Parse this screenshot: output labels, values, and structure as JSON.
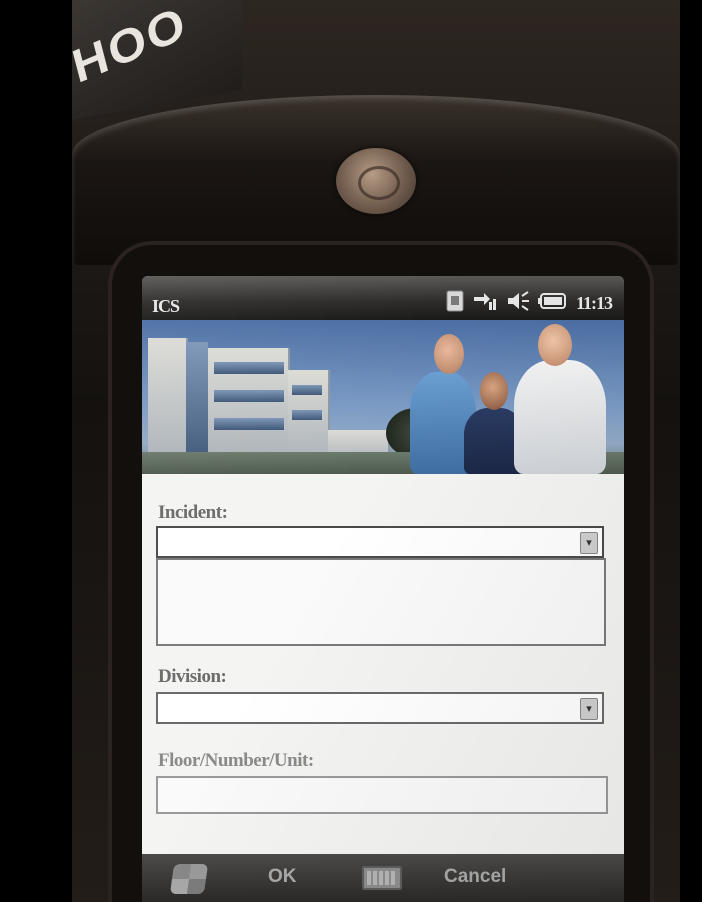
{
  "device": {
    "sticker_text": "HOO"
  },
  "status_bar": {
    "app_title": "ICS",
    "time": "11:13",
    "icons": [
      "sim-card-icon",
      "signal-transfer-icon",
      "volume-icon",
      "battery-icon"
    ]
  },
  "banner": {
    "image_name": "hospital-banner-image"
  },
  "form": {
    "incident_label": "Incident:",
    "incident_value": "",
    "incident_details_value": "",
    "division_label": "Division:",
    "division_value": "",
    "floor_label": "Floor/Number/Unit:",
    "floor_value": ""
  },
  "softkeys": {
    "ok_label": "OK",
    "cancel_label": "Cancel"
  },
  "colors": {
    "screen_bg": "#f2f1ee",
    "status_bar_bg": "#2b2a29",
    "softkey_bar_bg": "#3a3938",
    "banner_sky": "#5f84b5"
  }
}
